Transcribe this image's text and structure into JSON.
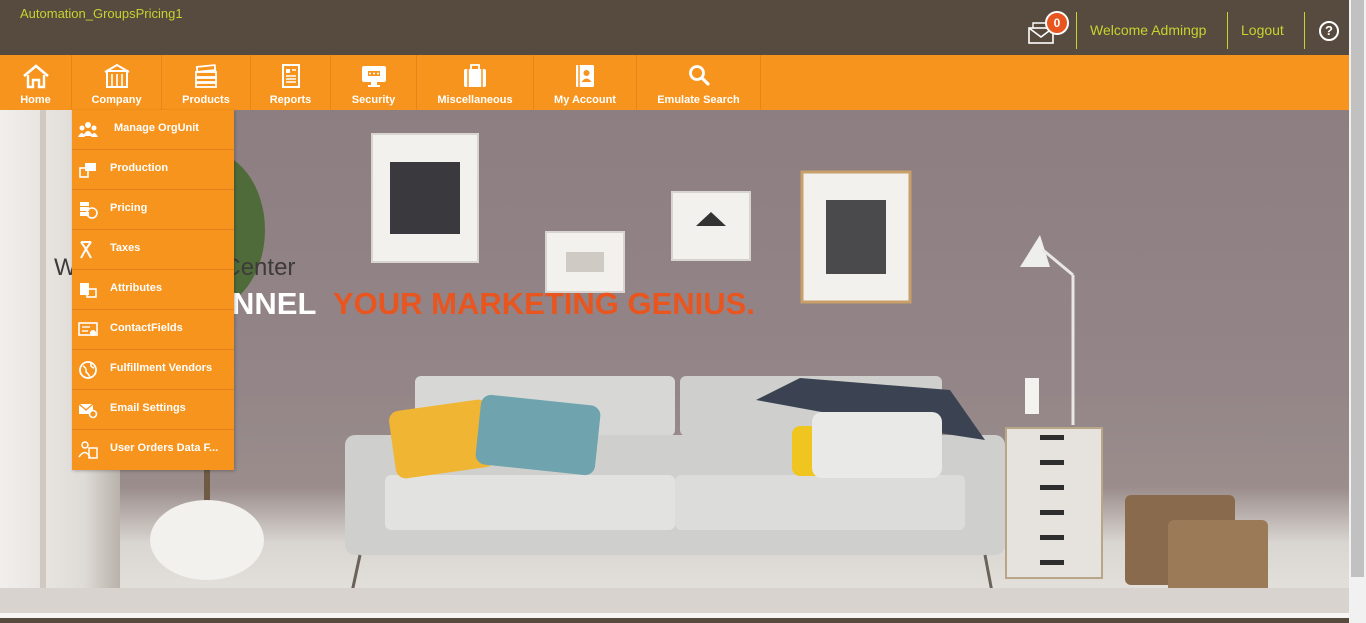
{
  "app": {
    "title": "Automation_GroupsPricing1"
  },
  "header": {
    "notifications_count": "0",
    "welcome": "Welcome Admingp",
    "logout": "Logout",
    "help": "?"
  },
  "nav": {
    "items": [
      {
        "label": "Home",
        "icon": "home-icon"
      },
      {
        "label": "Company",
        "icon": "building-icon"
      },
      {
        "label": "Products",
        "icon": "stack-icon"
      },
      {
        "label": "Reports",
        "icon": "report-icon"
      },
      {
        "label": "Security",
        "icon": "monitor-icon"
      },
      {
        "label": "Miscellaneous",
        "icon": "briefcase-icon"
      },
      {
        "label": "My Account",
        "icon": "account-book-icon"
      },
      {
        "label": "Emulate Search",
        "icon": "search-icon"
      }
    ]
  },
  "dropdown": {
    "items": [
      {
        "label": "Manage OrgUnit",
        "icon": "users-group-icon"
      },
      {
        "label": "Production",
        "icon": "production-icon"
      },
      {
        "label": "Pricing",
        "icon": "pricing-icon"
      },
      {
        "label": "Taxes",
        "icon": "taxes-icon"
      },
      {
        "label": "Attributes",
        "icon": "attributes-icon"
      },
      {
        "label": "ContactFields",
        "icon": "contact-fields-icon"
      },
      {
        "label": "Fulfillment Vendors",
        "icon": "globe-icon"
      },
      {
        "label": "Email Settings",
        "icon": "email-settings-icon"
      },
      {
        "label": "User Orders Data F...",
        "icon": "user-orders-icon"
      }
    ]
  },
  "hero": {
    "heading": "W                ur Marketing Center",
    "tagline_white": "NNEL",
    "tagline_orange": "YOUR MARKETING GENIUS."
  },
  "colors": {
    "topbar": "#574a3f",
    "nav": "#f7941d",
    "accent_text": "#c5d42f",
    "tagline_orange": "#e8551f"
  }
}
